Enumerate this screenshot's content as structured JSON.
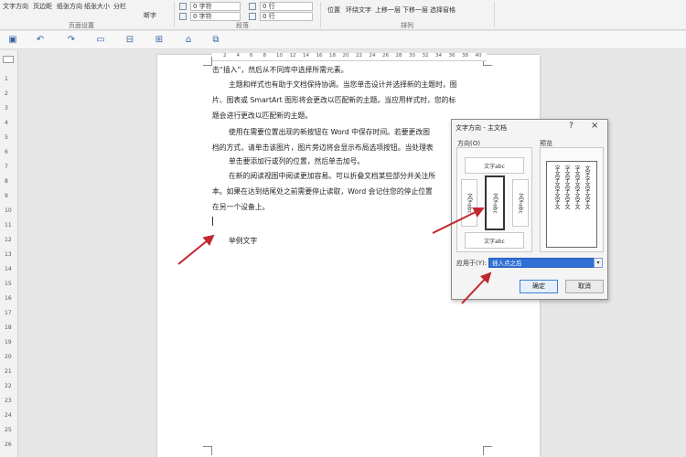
{
  "ribbon": {
    "buttons": [
      "文字方向",
      "页边距",
      "纸张方向",
      "纸张大小",
      "分栏"
    ],
    "page_setup_label": "页面设置",
    "paragraph_label": "段落",
    "arrange_label": "排列",
    "hyphen_label": "断字",
    "indent_left_value": "0 字符",
    "indent_right_value": "0 字符",
    "spacing_before_value": "0 行",
    "spacing_after_value": "0 行",
    "arrange_items": [
      "位置",
      "环绕文字",
      "上移一层",
      "下移一层",
      "选择窗格"
    ]
  },
  "ruler": {
    "h_ticks": [
      "2",
      "4",
      "6",
      "8",
      "10",
      "12",
      "14",
      "16",
      "18",
      "20",
      "22",
      "24",
      "26",
      "28",
      "30",
      "32",
      "34",
      "36",
      "38",
      "40"
    ],
    "v_ticks": [
      "1",
      "2",
      "3",
      "4",
      "5",
      "6",
      "7",
      "8",
      "9",
      "10",
      "11",
      "12",
      "13",
      "14",
      "15",
      "16",
      "17",
      "18",
      "19",
      "20",
      "21",
      "22",
      "23",
      "24",
      "25",
      "26"
    ]
  },
  "document": {
    "lines": [
      "击“插入”，然后从不同库中选择所需元素。",
      "主题和样式也有助于文档保持协调。当您单击设计并选择新的主题时，图",
      "片、图表或 SmartArt 图形将会更改以匹配新的主题。当应用样式时，您的标",
      "题会进行更改以匹配新的主题。",
      "使用在需要位置出现的新按钮在 Word 中保存时间。若要更改图",
      "档的方式，请单击该图片，图片旁边将会显示布局选项按钮。当处理表",
      "单击要添加行或列的位置，然后单击加号。",
      "在新的阅读视图中阅读更加容易。可以折叠文档某些部分并关注所",
      "本。如果在达到结尾处之前需要停止读取，Word 会记住您的停止位置",
      "在另一个设备上。",
      "举例文字"
    ]
  },
  "dialog": {
    "title": "文字方向 - 主文档",
    "help": "?",
    "close": "×",
    "orientation_label": "方向(O)",
    "preview_label": "预览",
    "opt_horizontal": "文字abc",
    "opt_vertical_selected": "文字abc",
    "opt_rotate_left": "文字abc",
    "opt_rotate_right": "文字abc",
    "opt_bottom": "文字abc",
    "preview_text": [
      "文字字文字文字文",
      "字文字文字文字文",
      "字文字文字文字文",
      "字文字文字文字文"
    ],
    "apply_label": "应用于(Y):",
    "apply_value": "插入点之后",
    "ok_label": "确定",
    "cancel_label": "取消"
  },
  "colors": {
    "arrow": "#c0282e",
    "select_highlight": "#2f6fd6"
  }
}
